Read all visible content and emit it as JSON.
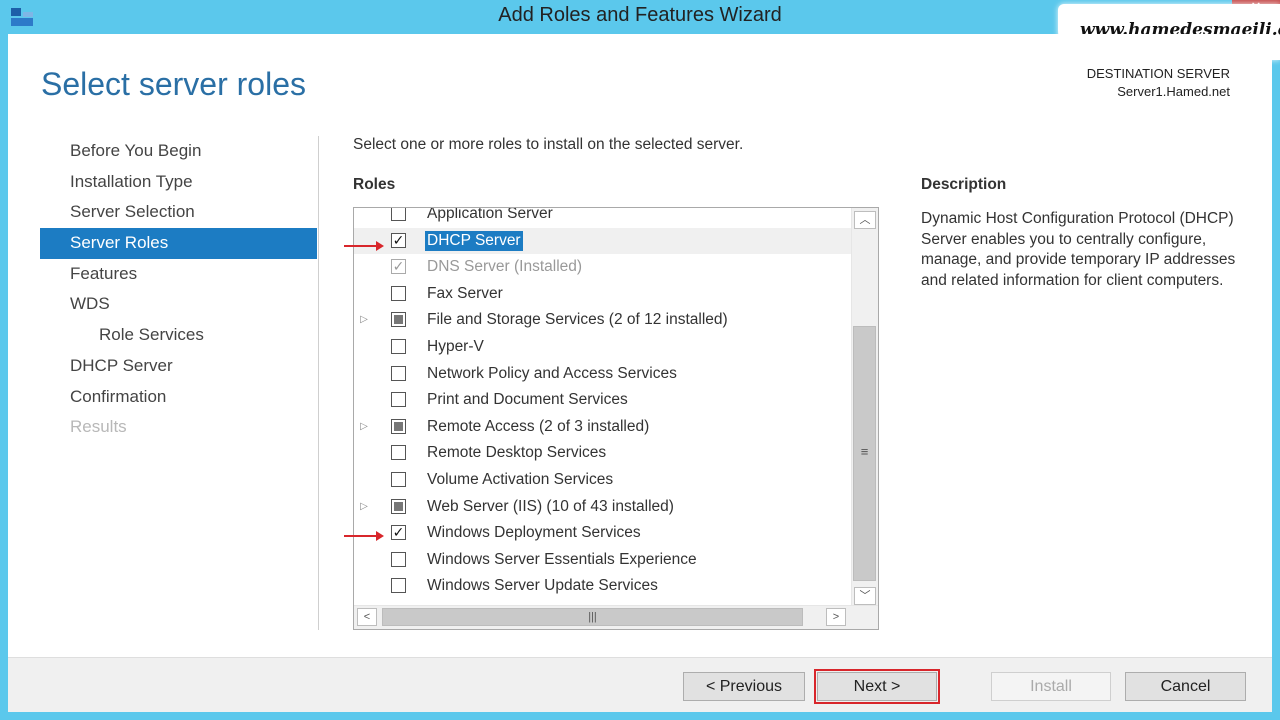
{
  "window": {
    "title": "Add Roles and Features Wizard",
    "watermark": "www.hamedesmaeili.com",
    "close_glyph": "✕"
  },
  "header": {
    "page_title": "Select server roles",
    "destination_label": "DESTINATION SERVER",
    "destination_server": "Server1.Hamed.net"
  },
  "nav": {
    "items": [
      {
        "label": "Before You Begin"
      },
      {
        "label": "Installation Type"
      },
      {
        "label": "Server Selection"
      },
      {
        "label": "Server Roles",
        "state": "active"
      },
      {
        "label": "Features"
      },
      {
        "label": "WDS"
      },
      {
        "label": "Role Services",
        "indent": true
      },
      {
        "label": "DHCP Server"
      },
      {
        "label": "Confirmation"
      },
      {
        "label": "Results",
        "state": "disabled"
      }
    ]
  },
  "content": {
    "instruction": "Select one or more roles to install on the selected server.",
    "roles_heading": "Roles",
    "description_heading": "Description",
    "description_text": "Dynamic Host Configuration Protocol (DHCP) Server enables you to centrally configure, manage, and provide temporary IP addresses and related information for client computers."
  },
  "roles": [
    {
      "label": "Application Server",
      "checked": false,
      "expandable": false
    },
    {
      "label": "DHCP Server",
      "checked": true,
      "selected": true,
      "expandable": false
    },
    {
      "label": "DNS Server (Installed)",
      "checked": true,
      "installed": true,
      "expandable": false
    },
    {
      "label": "Fax Server",
      "checked": false,
      "expandable": false
    },
    {
      "label": "File and Storage Services (2 of 12 installed)",
      "checked": "partial",
      "expandable": true
    },
    {
      "label": "Hyper-V",
      "checked": false,
      "expandable": false
    },
    {
      "label": "Network Policy and Access Services",
      "checked": false,
      "expandable": false
    },
    {
      "label": "Print and Document Services",
      "checked": false,
      "expandable": false
    },
    {
      "label": "Remote Access (2 of 3 installed)",
      "checked": "partial",
      "expandable": true
    },
    {
      "label": "Remote Desktop Services",
      "checked": false,
      "expandable": false
    },
    {
      "label": "Volume Activation Services",
      "checked": false,
      "expandable": false
    },
    {
      "label": "Web Server (IIS) (10 of 43 installed)",
      "checked": "partial",
      "expandable": true
    },
    {
      "label": "Windows Deployment Services",
      "checked": true,
      "expandable": false
    },
    {
      "label": "Windows Server Essentials Experience",
      "checked": false,
      "expandable": false
    },
    {
      "label": "Windows Server Update Services",
      "checked": false,
      "expandable": false
    }
  ],
  "scrollbar": {
    "up_glyph": "︿",
    "down_glyph": "﹀",
    "left_glyph": "<",
    "right_glyph": ">",
    "thumb_v_glyph": "≡",
    "thumb_h_glyph": "|||"
  },
  "buttons": {
    "previous": "< Previous",
    "next": "Next >",
    "install": "Install",
    "cancel": "Cancel"
  },
  "colors": {
    "frame": "#5bc8ec",
    "accent": "#1c7cc3",
    "title": "#2a6fa5",
    "annotation": "#d8262b"
  }
}
